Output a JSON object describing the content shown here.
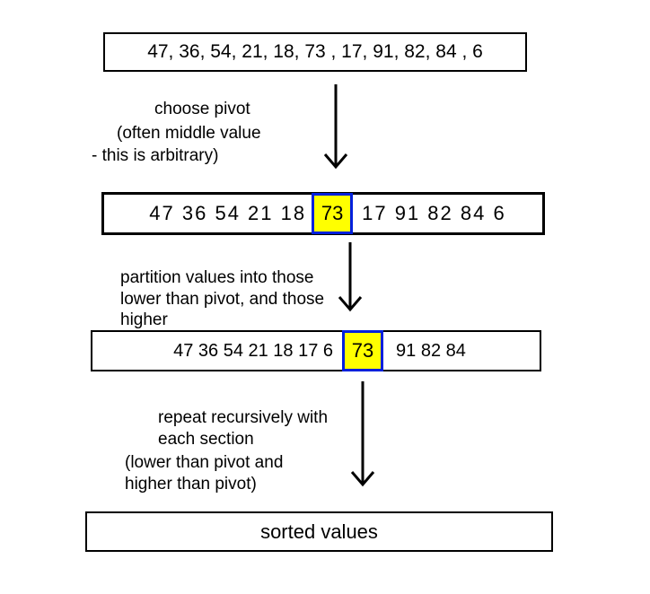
{
  "initialArray": "47, 36, 54, 21, 18, 73 , 17, 91, 82, 84 , 6",
  "step1": {
    "label_line1": "choose pivot",
    "label_line2": "(often  middle value",
    "label_line3": "- this is arbitrary)"
  },
  "step1Array": {
    "left": "47   36   54   21   18",
    "pivot": "73",
    "right": "17   91   82   84   6"
  },
  "step2": {
    "label": "partition values into those\nlower than pivot, and those\nhigher"
  },
  "step2Array": {
    "left": "47 36 54 21 18 17  6",
    "pivot": "73",
    "right": "91 82 84"
  },
  "step3": {
    "label_line1": "repeat recursively with\neach section",
    "label_line2": "(lower than pivot and\nhigher than pivot)"
  },
  "final": "sorted values",
  "chart_data": {
    "type": "diagram",
    "algorithm": "quicksort",
    "initial_values": [
      47,
      36,
      54,
      21,
      18,
      73,
      17,
      91,
      82,
      84,
      6
    ],
    "pivot": 73,
    "partition_lower": [
      47,
      36,
      54,
      21,
      18,
      17,
      6
    ],
    "partition_higher": [
      91,
      82,
      84
    ],
    "steps": [
      "choose pivot (often middle value - this is arbitrary)",
      "partition values into those lower than pivot, and those higher",
      "repeat recursively with each section (lower than pivot and higher than pivot)",
      "sorted values"
    ]
  }
}
